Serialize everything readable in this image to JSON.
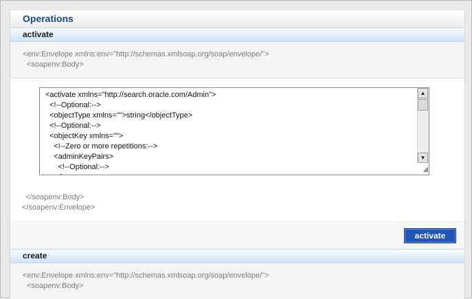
{
  "operations_title": "Operations",
  "activate_section": {
    "label": "activate",
    "envelope_open": "<env:Envelope xmlns:env=\"http://schemas.xmlsoap.org/soap/envelope/\">",
    "body_open": "<soapenv:Body>",
    "body_close": "</soapenv:Body>",
    "envelope_close": "</soapenv:Envelope>",
    "request_xml": [
      "<activate xmlns=\"http://search.oracle.com/Admin\">",
      "  <!--Optional:-->",
      "  <objectType xmlns=\"\">string</objectType>",
      "  <!--Optional:-->",
      "  <objectKey xmlns=\"\">",
      "    <!--Zero or more repetitions:-->",
      "    <adminKeyPairs>",
      "      <!--Optional:-->",
      "      <"
    ],
    "button_label": "activate"
  },
  "create_section": {
    "label": "create",
    "envelope_open": "<env:Envelope xmlns:env=\"http://schemas.xmlsoap.org/soap/envelope/\">",
    "body_open": "<soapenv:Body>"
  },
  "icons": {
    "scroll_up": "scroll-up-arrow",
    "scroll_down": "scroll-down-arrow",
    "resize": "resize-grip"
  }
}
